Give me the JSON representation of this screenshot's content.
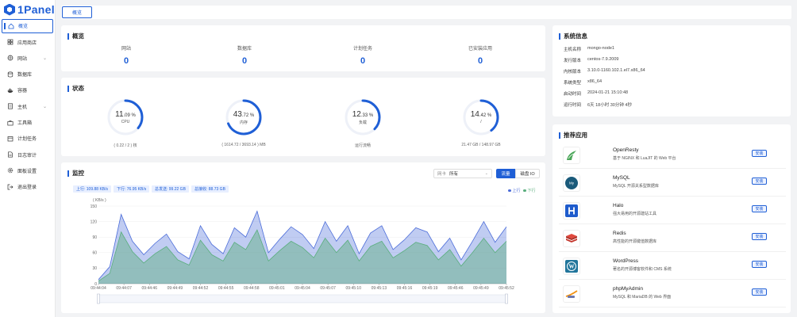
{
  "brand": {
    "name": "1Panel"
  },
  "colors": {
    "accent": "#1f5fd6",
    "upload": "#4b6cd9",
    "download": "#5aae7d"
  },
  "sidebar": {
    "items": [
      {
        "label": "概览",
        "icon": "home-icon",
        "active": true
      },
      {
        "label": "应用商店",
        "icon": "store-icon"
      },
      {
        "label": "网站",
        "icon": "website-icon",
        "expand": true
      },
      {
        "label": "数据库",
        "icon": "database-icon"
      },
      {
        "label": "容器",
        "icon": "container-icon"
      },
      {
        "label": "主机",
        "icon": "host-icon",
        "expand": true
      },
      {
        "label": "工具箱",
        "icon": "toolbox-icon"
      },
      {
        "label": "计划任务",
        "icon": "schedule-icon"
      },
      {
        "label": "日志审计",
        "icon": "log-icon"
      },
      {
        "label": "面板设置",
        "icon": "settings-icon"
      },
      {
        "label": "退出登录",
        "icon": "logout-icon"
      }
    ]
  },
  "topbar": {
    "tab": "概览"
  },
  "overview": {
    "title": "概览",
    "stats": [
      {
        "label": "网站",
        "value": "0"
      },
      {
        "label": "数据库",
        "value": "0"
      },
      {
        "label": "计划任务",
        "value": "0"
      },
      {
        "label": "已安装应用",
        "value": "0"
      }
    ]
  },
  "status": {
    "title": "状态",
    "gauges": [
      {
        "int": "11",
        "dec": ".09",
        "unit": "%",
        "percent": 11.09,
        "sub": "CPU",
        "foot": "( 0.22 / 2 ) 核"
      },
      {
        "int": "43",
        "dec": ".72",
        "unit": "%",
        "percent": 43.72,
        "sub": "内存",
        "foot": "( 1614.72 / 3693.14 ) MB"
      },
      {
        "int": "12",
        "dec": ".33",
        "unit": "%",
        "percent": 12.33,
        "sub": "负载",
        "foot": "运行流畅"
      },
      {
        "int": "14",
        "dec": ".42",
        "unit": "%",
        "percent": 14.42,
        "sub": "/",
        "foot": "21.47 GB / 148.97 GB"
      }
    ]
  },
  "monitor": {
    "title": "监控",
    "select_label": "网卡",
    "select_value": "所有",
    "seg_traffic": "流量",
    "seg_disk": "磁盘 IO",
    "tags": [
      "上行: 109.88 KB/s",
      "下行: 76.95 KB/s",
      "总发送: 99.22 GB",
      "总接收: 88.73 GB"
    ],
    "legend_up": "上行",
    "legend_down": "下行"
  },
  "chart_data": {
    "type": "area",
    "ylabel": "( KB/s )",
    "ylim": [
      0,
      150
    ],
    "yticks": [
      "150",
      "120",
      "90",
      "60",
      "30",
      "0"
    ],
    "x": [
      "09:44:04",
      "09:44:07",
      "09:44:46",
      "09:44:49",
      "09:44:52",
      "09:44:55",
      "09:44:58",
      "09:45:01",
      "09:45:04",
      "09:45:07",
      "09:45:10",
      "09:45:13",
      "09:45:16",
      "09:45:19",
      "09:45:46",
      "09:45:49",
      "09:45:52"
    ],
    "series": [
      {
        "name": "上行",
        "values": [
          8,
          33,
          134,
          82,
          56,
          78,
          96,
          62,
          48,
          112,
          76,
          58,
          108,
          90,
          140,
          60,
          86,
          110,
          95,
          68,
          120,
          82,
          112,
          58,
          98,
          112,
          66,
          85,
          108,
          100,
          62,
          88,
          46,
          82,
          120,
          80,
          110
        ]
      },
      {
        "name": "下行",
        "values": [
          5,
          20,
          100,
          62,
          40,
          58,
          72,
          46,
          36,
          84,
          56,
          44,
          80,
          66,
          104,
          44,
          64,
          82,
          70,
          50,
          88,
          60,
          84,
          44,
          72,
          82,
          50,
          64,
          80,
          74,
          46,
          66,
          34,
          60,
          88,
          60,
          82
        ]
      }
    ]
  },
  "system_info": {
    "title": "系统信息",
    "rows": [
      {
        "key": "主机名称",
        "value": "mongo-node1"
      },
      {
        "key": "发行版本",
        "value": "centos-7.9.2009"
      },
      {
        "key": "内核版本",
        "value": "3.10.0-1160.102.1.el7.x86_64"
      },
      {
        "key": "系统类型",
        "value": "x86_64"
      },
      {
        "key": "启动时间",
        "value": "2024-01-21 15:10:48"
      },
      {
        "key": "运行时间",
        "value": "6天 18小时 30分钟 4秒"
      }
    ]
  },
  "recommended": {
    "title": "推荐应用",
    "install_label": "安装",
    "apps": [
      {
        "name": "OpenResty",
        "desc": "基于 NGINX 和 LuaJIT 的 Web 平台",
        "icon": "openresty-icon"
      },
      {
        "name": "MySQL",
        "desc": "MySQL 开源关系型数据库",
        "icon": "mysql-icon"
      },
      {
        "name": "Halo",
        "desc": "强大易用的开源建站工具",
        "icon": "halo-icon"
      },
      {
        "name": "Redis",
        "desc": "高性能的开源键值数据库",
        "icon": "redis-icon"
      },
      {
        "name": "WordPress",
        "desc": "著名的开源博客软件和 CMS 系统",
        "icon": "wordpress-icon"
      },
      {
        "name": "phpMyAdmin",
        "desc": "MySQL 和 MariaDB 的 Web 界面",
        "icon": "phpmyadmin-icon"
      }
    ]
  }
}
